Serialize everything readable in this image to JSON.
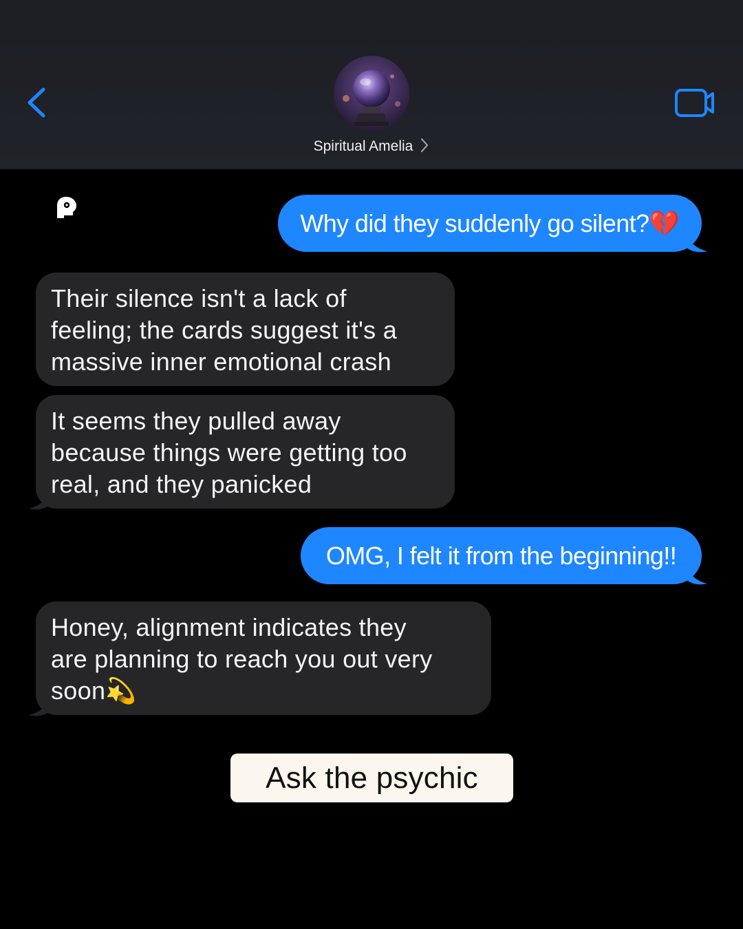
{
  "header": {
    "contact_name": "Spiritual Amelia",
    "accent_color": "#1e86ff"
  },
  "icons": {
    "back": "chevron-left-icon",
    "video": "video-camera-icon",
    "contact_chevron": "chevron-right-icon",
    "logo": "head-profile-logo"
  },
  "messages": [
    {
      "from": "me",
      "text": "Why did they suddenly go silent?💔"
    },
    {
      "from": "psychic",
      "lines": [
        "Their silence isn't a lack of",
        "feeling; the cards suggest it's a",
        "massive inner emotional crash"
      ]
    },
    {
      "from": "psychic",
      "lines": [
        "It seems they pulled away",
        "because things were getting too",
        "real, and they panicked"
      ]
    },
    {
      "from": "me",
      "text": "OMG, I felt it from the beginning!!"
    },
    {
      "from": "psychic",
      "lines": [
        "Honey, alignment indicates they",
        "are planning to reach you out very",
        "soon💫"
      ]
    }
  ],
  "cta": {
    "label": "Ask the psychic"
  }
}
